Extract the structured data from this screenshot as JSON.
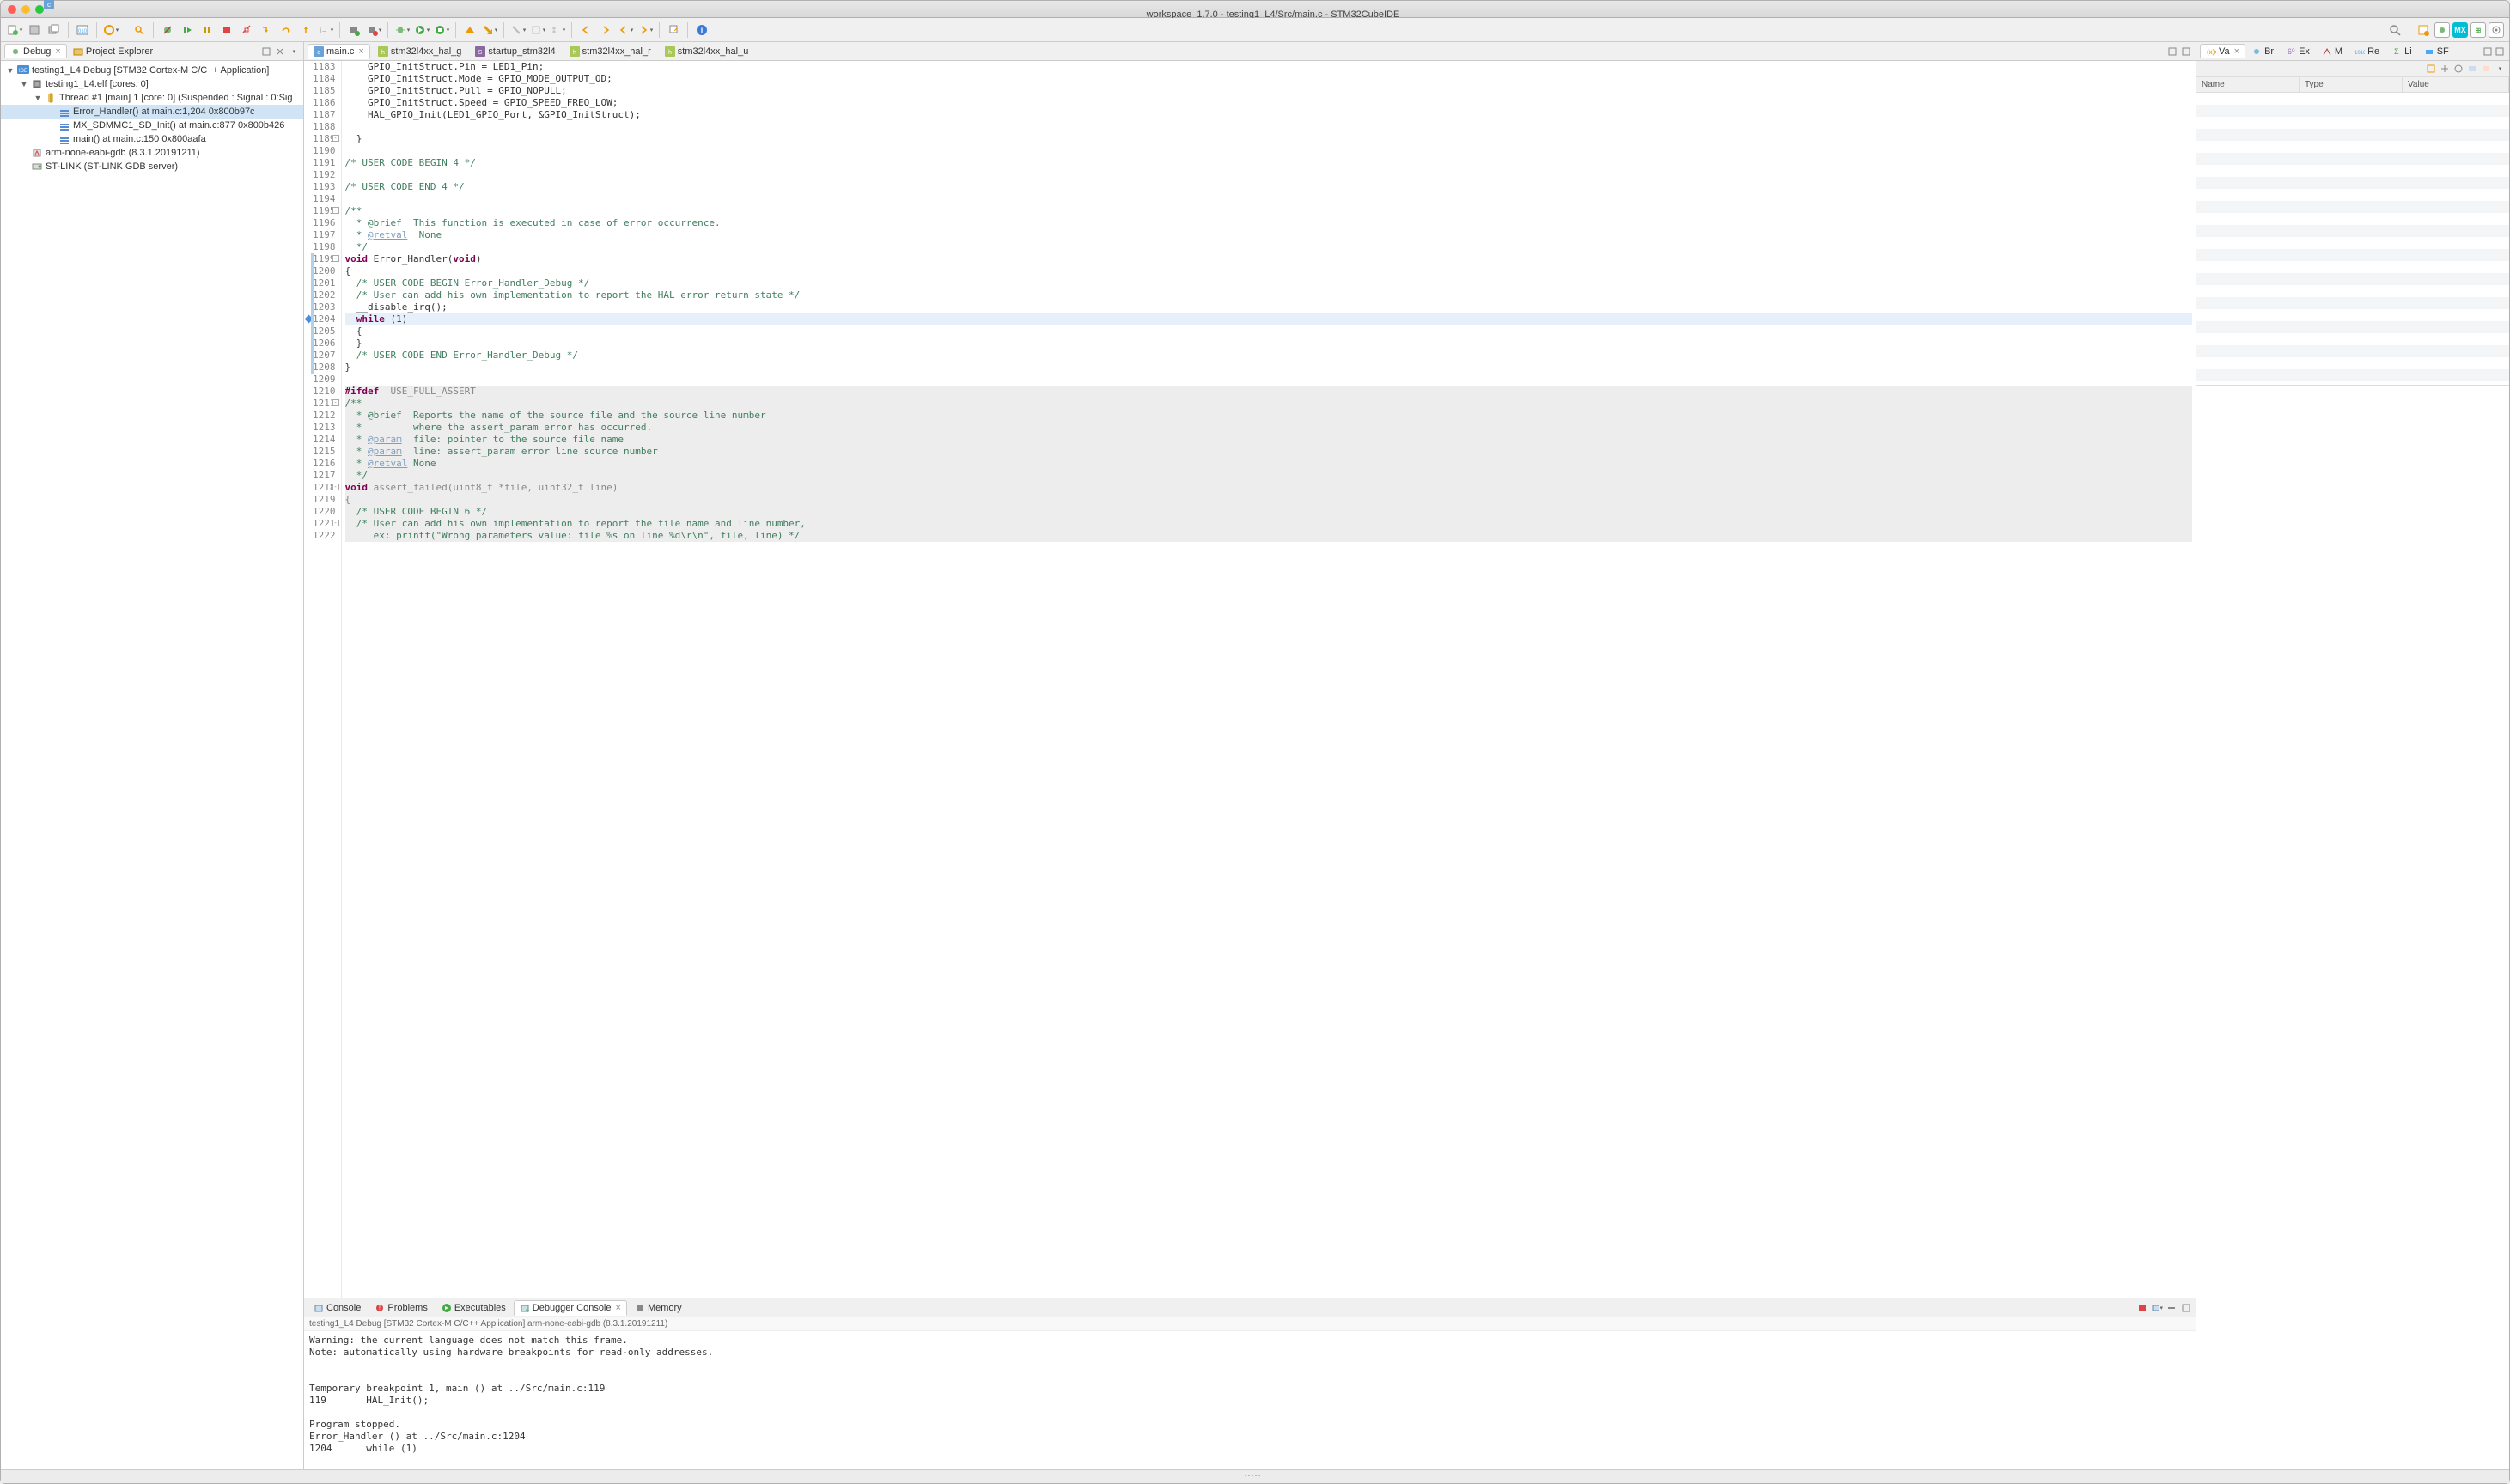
{
  "window_title": "workspace_1.7.0 - testing1_L4/Src/main.c - STM32CubeIDE",
  "left_views": {
    "debug": "Debug",
    "explorer": "Project Explorer"
  },
  "debug_tree": [
    {
      "depth": 0,
      "tw": "▼",
      "icon": "ide",
      "label": "testing1_L4 Debug [STM32 Cortex-M C/C++ Application]"
    },
    {
      "depth": 1,
      "tw": "▼",
      "icon": "chip",
      "label": "testing1_L4.elf [cores: 0]"
    },
    {
      "depth": 2,
      "tw": "▼",
      "icon": "thread",
      "label": "Thread #1 [main] 1 [core: 0] (Suspended : Signal : 0:Sig"
    },
    {
      "depth": 3,
      "tw": "",
      "icon": "stack",
      "label": "Error_Handler() at main.c:1,204 0x800b97c",
      "sel": true
    },
    {
      "depth": 3,
      "tw": "",
      "icon": "stack",
      "label": "MX_SDMMC1_SD_Init() at main.c:877 0x800b426"
    },
    {
      "depth": 3,
      "tw": "",
      "icon": "stack",
      "label": "main() at main.c:150 0x800aafa"
    },
    {
      "depth": 1,
      "tw": "",
      "icon": "gdb",
      "label": "arm-none-eabi-gdb (8.3.1.20191211)"
    },
    {
      "depth": 1,
      "tw": "",
      "icon": "stlink",
      "label": "ST-LINK (ST-LINK GDB server)"
    }
  ],
  "editor_tabs": [
    {
      "icon": "c",
      "label": "main.c",
      "active": true,
      "close": true
    },
    {
      "icon": "h",
      "label": "stm32l4xx_hal_g"
    },
    {
      "icon": "s",
      "label": "startup_stm32l4"
    },
    {
      "icon": "h",
      "label": "stm32l4xx_hal_r"
    },
    {
      "icon": "h",
      "label": "stm32l4xx_hal_u"
    }
  ],
  "code": [
    {
      "n": 1183,
      "t": "    GPIO_InitStruct.Pin = LED1_Pin;"
    },
    {
      "n": 1184,
      "t": "    GPIO_InitStruct.Mode = GPIO_MODE_OUTPUT_OD;"
    },
    {
      "n": 1185,
      "t": "    GPIO_InitStruct.Pull = GPIO_NOPULL;"
    },
    {
      "n": 1186,
      "t": "    GPIO_InitStruct.Speed = GPIO_SPEED_FREQ_LOW;"
    },
    {
      "n": 1187,
      "t": "    HAL_GPIO_Init(LED1_GPIO_Port, &GPIO_InitStruct);"
    },
    {
      "n": 1188,
      "t": ""
    },
    {
      "n": 1189,
      "t": "  }",
      "fold": true
    },
    {
      "n": 1190,
      "t": ""
    },
    {
      "n": 1191,
      "t": "/* USER CODE BEGIN 4 */",
      "cm": true
    },
    {
      "n": 1192,
      "t": ""
    },
    {
      "n": 1193,
      "t": "/* USER CODE END 4 */",
      "cm": true
    },
    {
      "n": 1194,
      "t": ""
    },
    {
      "n": 1195,
      "t": "/**",
      "cm": true,
      "fold": true
    },
    {
      "n": 1196,
      "t": "  * @brief  This function is executed in case of error occurrence.",
      "cm": true
    },
    {
      "n": 1197,
      "t": "  * @retval  None",
      "cm": true,
      "tag": "retval"
    },
    {
      "n": 1198,
      "t": "  */",
      "cm": true
    },
    {
      "n": 1199,
      "t": "void Error_Handler(void)",
      "sig": true,
      "fold": true,
      "mark": "#b3d0e6"
    },
    {
      "n": 1200,
      "t": "{",
      "mark": "#b3d0e6"
    },
    {
      "n": 1201,
      "t": "  /* USER CODE BEGIN Error_Handler_Debug */",
      "cm": true,
      "mark": "#b3d0e6"
    },
    {
      "n": 1202,
      "t": "  /* User can add his own implementation to report the HAL error return state */",
      "cm": true,
      "mark": "#b3d0e6"
    },
    {
      "n": 1203,
      "t": "  __disable_irq();",
      "mark": "#b3d0e6"
    },
    {
      "n": 1204,
      "t": "  while (1)",
      "exec": true,
      "bp": true,
      "mark": "#b3d0e6"
    },
    {
      "n": 1205,
      "t": "  {",
      "mark": "#b3d0e6"
    },
    {
      "n": 1206,
      "t": "  }",
      "mark": "#b3d0e6"
    },
    {
      "n": 1207,
      "t": "  /* USER CODE END Error_Handler_Debug */",
      "cm": true,
      "mark": "#b3d0e6"
    },
    {
      "n": 1208,
      "t": "}",
      "mark": "#b3d0e6"
    },
    {
      "n": 1209,
      "t": ""
    },
    {
      "n": 1210,
      "t": "#ifdef  USE_FULL_ASSERT",
      "pp": true,
      "dead": true
    },
    {
      "n": 1211,
      "t": "/**",
      "cm": true,
      "dead": true,
      "fold": true
    },
    {
      "n": 1212,
      "t": "  * @brief  Reports the name of the source file and the source line number",
      "cm": true,
      "dead": true
    },
    {
      "n": 1213,
      "t": "  *         where the assert_param error has occurred.",
      "cm": true,
      "dead": true
    },
    {
      "n": 1214,
      "t": "  * @param  file: pointer to the source file name",
      "cm": true,
      "tag": "param",
      "dead": true
    },
    {
      "n": 1215,
      "t": "  * @param  line: assert_param error line source number",
      "cm": true,
      "tag": "param",
      "dead": true
    },
    {
      "n": 1216,
      "t": "  * @retval None",
      "cm": true,
      "tag": "retval",
      "dead": true
    },
    {
      "n": 1217,
      "t": "  */",
      "cm": true,
      "dead": true
    },
    {
      "n": 1218,
      "t": "void assert_failed(uint8_t *file, uint32_t line)",
      "sig": true,
      "dead": true,
      "fold": true
    },
    {
      "n": 1219,
      "t": "{",
      "dead": true
    },
    {
      "n": 1220,
      "t": "  /* USER CODE BEGIN 6 */",
      "cm": true,
      "dead": true
    },
    {
      "n": 1221,
      "t": "  /* User can add his own implementation to report the file name and line number,",
      "cm": true,
      "dead": true,
      "fold": true
    },
    {
      "n": 1222,
      "t": "     ex: printf(\"Wrong parameters value: file %s on line %d\\r\\n\", file, line) */",
      "cm": true,
      "dead": true
    }
  ],
  "right_tabs": [
    "Va",
    "Br",
    "Ex",
    "M",
    "Re",
    "Li",
    "SF"
  ],
  "var_cols": {
    "name": "Name",
    "type": "Type",
    "value": "Value"
  },
  "bottom_tabs": [
    {
      "label": "Console"
    },
    {
      "label": "Problems"
    },
    {
      "label": "Executables"
    },
    {
      "label": "Debugger Console",
      "active": true,
      "close": true
    },
    {
      "label": "Memory"
    }
  ],
  "debug_subtitle": "testing1_L4 Debug [STM32 Cortex-M C/C++ Application] arm-none-eabi-gdb (8.3.1.20191211)",
  "console_text": "Warning: the current language does not match this frame.\nNote: automatically using hardware breakpoints for read-only addresses.\n\n\nTemporary breakpoint 1, main () at ../Src/main.c:119\n119       HAL_Init();\n\nProgram stopped.\nError_Handler () at ../Src/main.c:1204\n1204      while (1)"
}
